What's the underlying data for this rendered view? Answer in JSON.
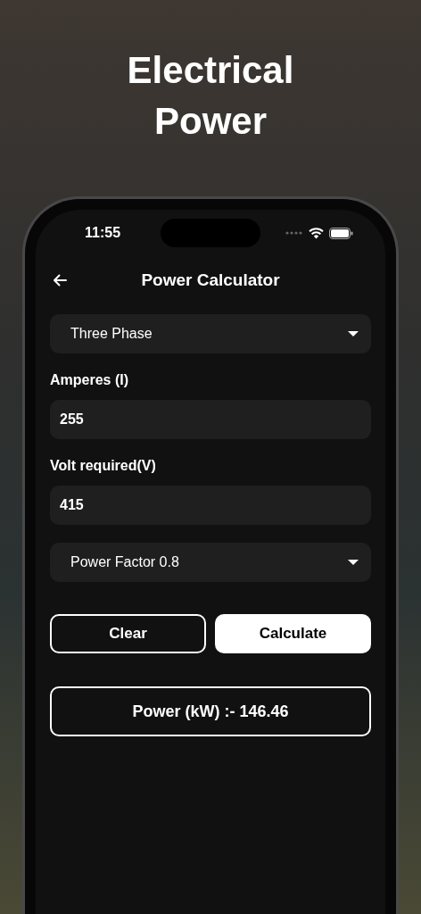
{
  "headline": "Electrical Power",
  "status_bar": {
    "time": "11:55"
  },
  "app_bar": {
    "title": "Power Calculator"
  },
  "form": [
    {
      "kind": "dropdown",
      "value": "Three Phase"
    },
    {
      "kind": "input",
      "label": "Amperes (I)",
      "value": "255"
    },
    {
      "kind": "input",
      "label": "Volt required(V)",
      "value": "415"
    },
    {
      "kind": "dropdown",
      "value": "Power Factor 0.8"
    }
  ],
  "buttons": [
    {
      "label": "Clear",
      "kind": "outline"
    },
    {
      "label": "Calculate",
      "kind": "filled"
    }
  ],
  "result": "Power (kW) :- 146.46"
}
